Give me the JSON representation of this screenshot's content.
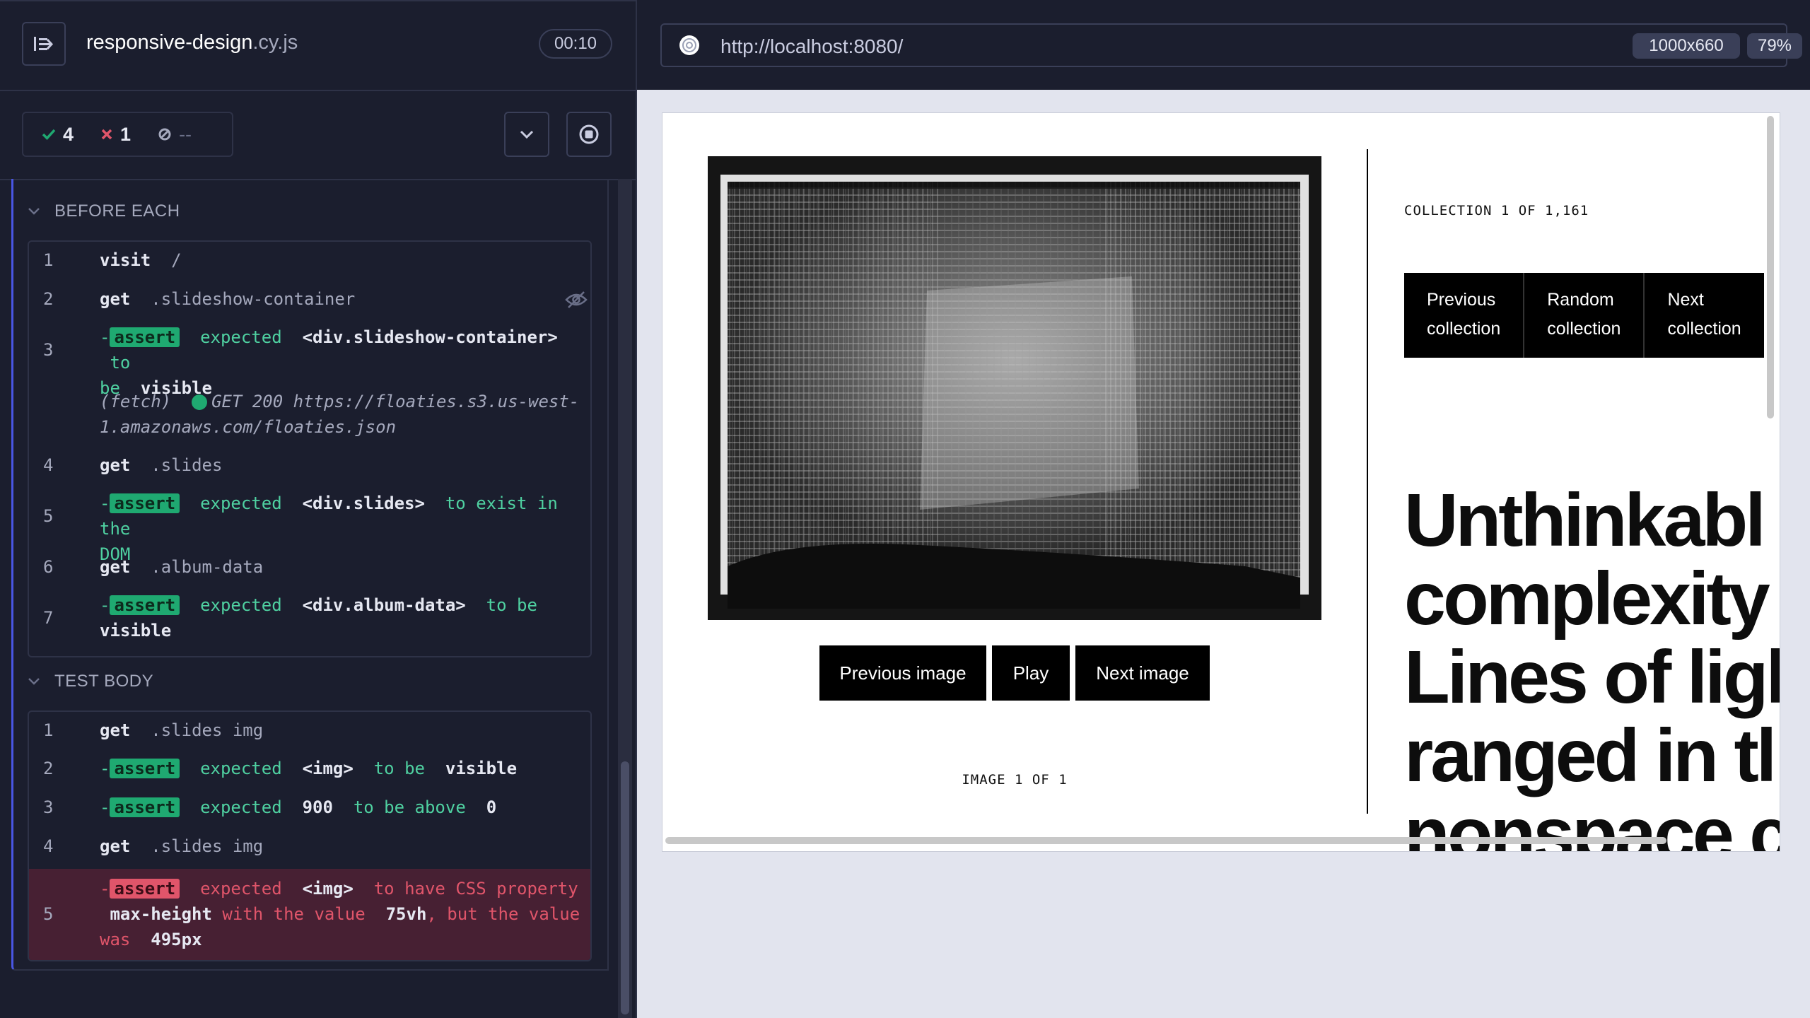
{
  "header": {
    "spec_name": "responsive-design",
    "spec_ext": ".cy.js",
    "timer": "00:10"
  },
  "stats": {
    "passed": "4",
    "failed": "1",
    "pending": "--"
  },
  "before_each": {
    "title": "BEFORE EACH",
    "commands": [
      {
        "num": "1",
        "cmd": "visit",
        "arg": "/"
      },
      {
        "num": "2",
        "cmd": "get",
        "arg": ".slideshow-container"
      },
      {
        "num": "3",
        "badge": "assert",
        "t1": "expected",
        "t2": "<div.slideshow-container>",
        "t3": "to",
        "t4": "be",
        "t5": "visible"
      },
      {
        "fetch": "(fetch)",
        "fetch_text": "GET 200 https://floaties.s3.us-west-",
        "fetch_text2": "1.amazonaws.com/floaties.json"
      },
      {
        "num": "4",
        "cmd": "get",
        "arg": ".slides"
      },
      {
        "num": "5",
        "badge": "assert",
        "t1": "expected",
        "t2": "<div.slides>",
        "t3": "to exist in the",
        "t4": "DOM"
      },
      {
        "num": "6",
        "cmd": "get",
        "arg": ".album-data"
      },
      {
        "num": "7",
        "badge": "assert",
        "t1": "expected",
        "t2": "<div.album-data>",
        "t3": "to be",
        "t4": "visible"
      }
    ]
  },
  "test_body": {
    "title": "TEST BODY",
    "commands": [
      {
        "num": "1",
        "cmd": "get",
        "arg": ".slides img"
      },
      {
        "num": "2",
        "badge": "assert",
        "t1": "expected",
        "t2": "<img>",
        "t3": "to be",
        "t4": "visible"
      },
      {
        "num": "3",
        "badge": "assert",
        "t1": "expected",
        "t2": "900",
        "t3": "to be above",
        "t4": "0"
      },
      {
        "num": "4",
        "cmd": "get",
        "arg": ".slides img"
      },
      {
        "num": "5",
        "badge": "assert",
        "t1": "expected",
        "t2": "<img>",
        "t3": "to have CSS property",
        "t4": "max-height",
        "t5": "with the value",
        "t6": "75vh",
        "t7": ", but the value",
        "t8": "was",
        "t9": "495px"
      }
    ]
  },
  "browser": {
    "url": "http://localhost:8080/",
    "viewport": "1000x660",
    "zoom": "79%"
  },
  "app": {
    "btn_prev_image": "Previous image",
    "btn_play": "Play",
    "btn_next_image": "Next image",
    "image_counter": "IMAGE 1 OF 1",
    "collection_counter": "COLLECTION 1 OF 1,161",
    "btn_prev_collection": [
      "Previous",
      "collection"
    ],
    "btn_random_collection": [
      "Random",
      "collection"
    ],
    "btn_next_collection": [
      "Next",
      "collection"
    ],
    "headline_lines": [
      "Unthinkabl",
      "complexity",
      "Lines of ligl",
      "ranged in tl",
      "nonspace c"
    ]
  },
  "colors": {
    "pass": "#1fa971",
    "fail": "#e0556a",
    "accent": "#4956e3"
  }
}
